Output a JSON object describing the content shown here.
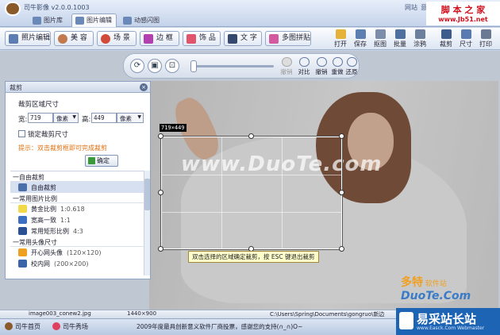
{
  "app": {
    "title": "司牛影像 v2.0.0.1003"
  },
  "tabs": [
    {
      "label": "图片库"
    },
    {
      "label": "图片编辑"
    },
    {
      "label": "动感闪图"
    }
  ],
  "titlebar_right": {
    "site": "网站",
    "partial": "意"
  },
  "watermark_top": {
    "line1": "脚 本 之 家",
    "line2": "www.Jb51.net"
  },
  "toolbar": {
    "left": [
      "照片编辑",
      "美 容",
      "场 景",
      "边 框",
      "饰 品",
      "文 字",
      "多图拼贴"
    ],
    "right": [
      "打开",
      "保存",
      "抠图",
      "批量",
      "涂鸦",
      "裁剪",
      "尺寸",
      "打印"
    ]
  },
  "view_bar": {
    "icons": [
      "rotate-icon",
      "actual-size-icon",
      "fit-icon"
    ],
    "actions": [
      {
        "label": "撤销",
        "disabled": true
      },
      {
        "label": "对比",
        "disabled": false
      },
      {
        "label": "撤销",
        "disabled": false
      },
      {
        "label": "重做",
        "disabled": false
      },
      {
        "label": "还原",
        "disabled": false
      }
    ]
  },
  "panel": {
    "title": "裁剪",
    "section_label": "裁剪区域尺寸",
    "width_label": "宽:",
    "width_value": "719",
    "width_unit": "像素",
    "height_label": "高:",
    "height_value": "449",
    "height_unit": "像素",
    "lock_label": "锁定裁剪尺寸",
    "lock_checked": false,
    "tip": "提示：双击裁剪框即可完成裁剪",
    "ok_label": "确定",
    "sections": [
      {
        "label": "一自由裁剪",
        "items": [
          {
            "name": "自由裁剪",
            "sub": "",
            "color": "#4a6fa8",
            "selected": true
          }
        ]
      },
      {
        "label": "一常用图片比例",
        "items": [
          {
            "name": "黄金比例",
            "sub": "1:0.618",
            "color": "#f2d94a",
            "selected": false
          },
          {
            "name": "宽高一致",
            "sub": "1:1",
            "color": "#3a6fc2",
            "selected": false
          },
          {
            "name": "常用矩形比例",
            "sub": "4:3",
            "color": "#2a4f93",
            "selected": false
          }
        ]
      },
      {
        "label": "一常用头像尺寸",
        "items": [
          {
            "name": "开心网头像",
            "sub": "(120×120)",
            "color": "#f0a020",
            "selected": false
          },
          {
            "name": "校内网",
            "sub": "(200×200)",
            "color": "#3a63a8",
            "selected": false
          }
        ]
      }
    ]
  },
  "canvas": {
    "crop_size_label": "719×449",
    "hint": "双击选择的区域确定裁剪，按 ESC 键退出裁剪",
    "brand_watermark": "www.DuoTe.com",
    "duote_logo": {
      "line1": "多特",
      "line2": "软件站",
      "line3": "DuoTe.Com"
    }
  },
  "status": {
    "filename": "image003_conew2.jpg",
    "dimensions": "1440×900",
    "path": "C:\\Users\\Spring\\Documents\\gongruo\\新边"
  },
  "bottom": {
    "home": "司牛首页",
    "show": "司牛秀场",
    "notice": "2009年度最具创新意义软件厂商投票，感谢您的支持(∩_∩)O~"
  },
  "watermark_bottom": {
    "line1": "易采站长站",
    "line2": "www.Easck.Com Webmaster"
  }
}
